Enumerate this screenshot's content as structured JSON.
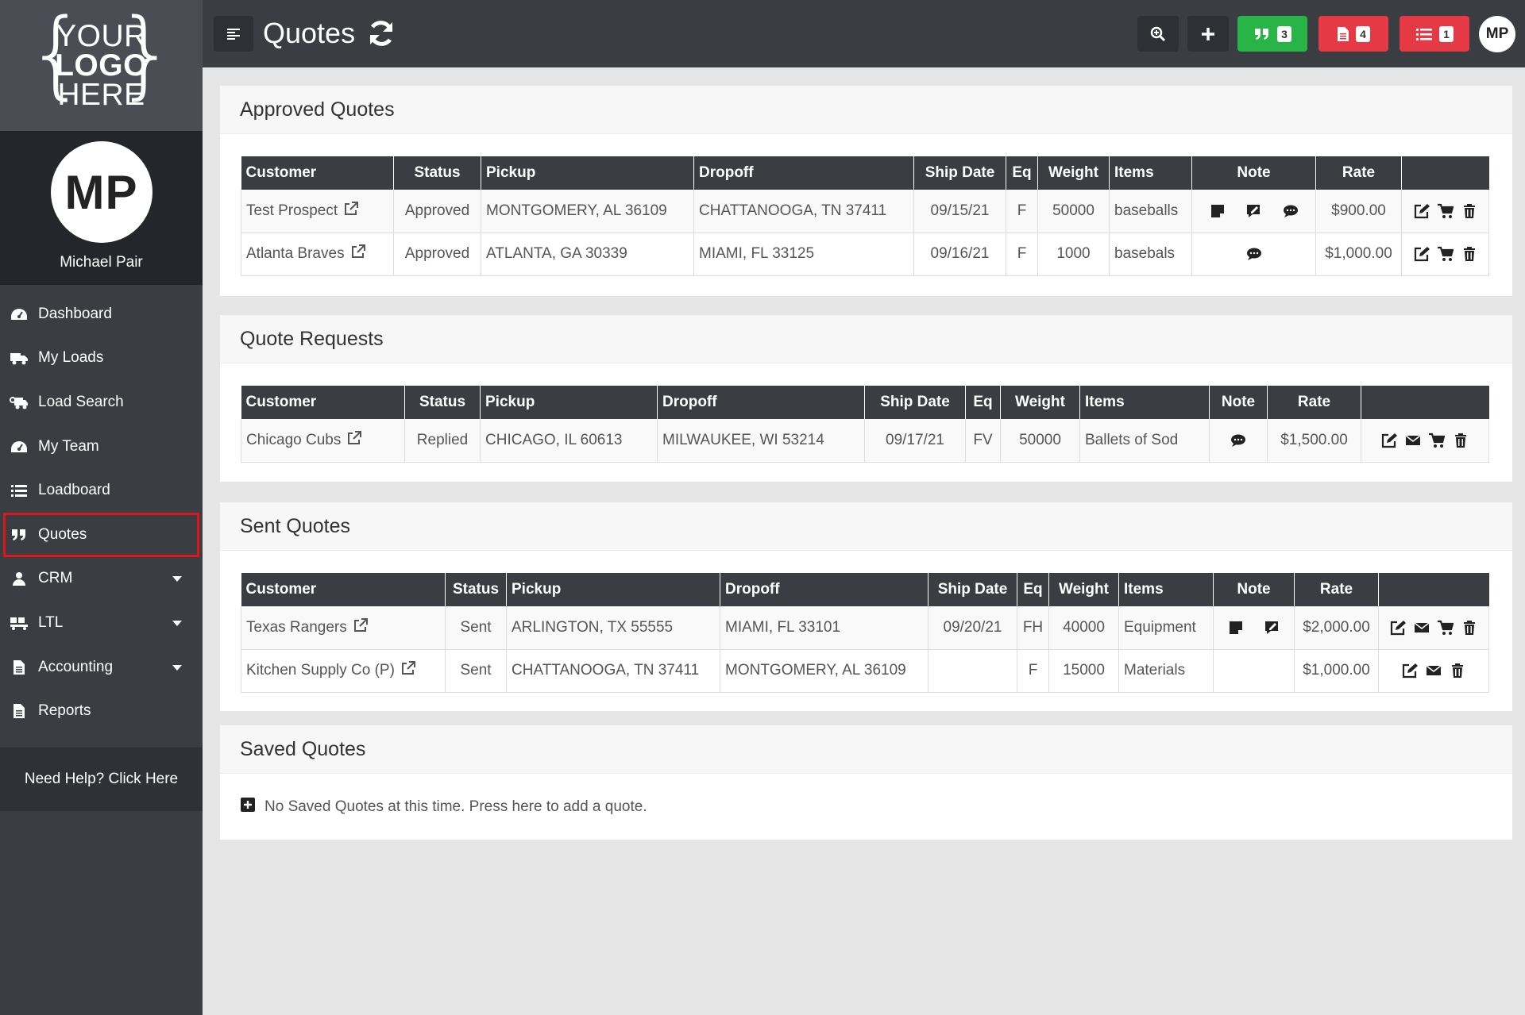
{
  "logo": {
    "line1": "YOUR",
    "line2": "LOGO",
    "line3": "HERE"
  },
  "profile": {
    "initials": "MP",
    "name": "Michael Pair"
  },
  "nav": [
    {
      "label": "Dashboard",
      "icon": "dashboard-icon"
    },
    {
      "label": "My Loads",
      "icon": "truck-icon"
    },
    {
      "label": "Load Search",
      "icon": "truck-search-icon"
    },
    {
      "label": "My Team",
      "icon": "team-icon"
    },
    {
      "label": "Loadboard",
      "icon": "list-icon"
    },
    {
      "label": "Quotes",
      "icon": "quote-icon",
      "active": true
    },
    {
      "label": "CRM",
      "icon": "user-icon",
      "dropdown": true
    },
    {
      "label": "LTL",
      "icon": "ltl-icon",
      "dropdown": true
    },
    {
      "label": "Accounting",
      "icon": "file-icon",
      "dropdown": true
    },
    {
      "label": "Reports",
      "icon": "report-icon"
    }
  ],
  "help": "Need Help? Click Here",
  "topbar": {
    "title": "Quotes",
    "quote_count": "3",
    "doc_count": "4",
    "list_count": "1",
    "avatar": "MP",
    "colors": {
      "green": "#28b446",
      "red": "#e63946",
      "dark": "#3a3d42"
    }
  },
  "approved": {
    "title": "Approved Quotes",
    "headers": [
      "Customer",
      "Status",
      "Pickup",
      "Dropoff",
      "Ship Date",
      "Eq",
      "Weight",
      "Items",
      "Note",
      "Rate",
      ""
    ],
    "rows": [
      {
        "customer": "Test Prospect",
        "status": "Approved",
        "pickup": "MONTGOMERY, AL 36109",
        "dropoff": "CHATTANOOGA, TN 37411",
        "ship_date": "09/15/21",
        "eq": "F",
        "weight": "50000",
        "items": "baseballs",
        "rate": "$900.00"
      },
      {
        "customer": "Atlanta Braves",
        "status": "Approved",
        "pickup": "ATLANTA, GA 30339",
        "dropoff": "MIAMI, FL 33125",
        "ship_date": "09/16/21",
        "eq": "F",
        "weight": "1000",
        "items": "basebals",
        "rate": "$1,000.00"
      }
    ]
  },
  "requests": {
    "title": "Quote Requests",
    "headers": [
      "Customer",
      "Status",
      "Pickup",
      "Dropoff",
      "Ship Date",
      "Eq",
      "Weight",
      "Items",
      "Note",
      "Rate",
      ""
    ],
    "rows": [
      {
        "customer": "Chicago Cubs",
        "status": "Replied",
        "pickup": "CHICAGO, IL 60613",
        "dropoff": "MILWAUKEE, WI 53214",
        "ship_date": "09/17/21",
        "eq": "FV",
        "weight": "50000",
        "items": "Ballets of Sod",
        "rate": "$1,500.00"
      }
    ]
  },
  "sent": {
    "title": "Sent Quotes",
    "headers": [
      "Customer",
      "Status",
      "Pickup",
      "Dropoff",
      "Ship Date",
      "Eq",
      "Weight",
      "Items",
      "Note",
      "Rate",
      ""
    ],
    "rows": [
      {
        "customer": "Texas Rangers",
        "status": "Sent",
        "pickup": "ARLINGTON, TX 55555",
        "dropoff": "MIAMI, FL 33101",
        "ship_date": "09/20/21",
        "eq": "FH",
        "weight": "40000",
        "items": "Equipment",
        "rate": "$2,000.00"
      },
      {
        "customer": "Kitchen Supply Co (P)",
        "status": "Sent",
        "pickup": "CHATTANOOGA, TN 37411",
        "dropoff": "MONTGOMERY, AL 36109",
        "ship_date": "",
        "eq": "F",
        "weight": "15000",
        "items": "Materials",
        "rate": "$1,000.00"
      }
    ]
  },
  "saved": {
    "title": "Saved Quotes",
    "empty_text": "No Saved Quotes at this time. Press here to add a quote."
  }
}
